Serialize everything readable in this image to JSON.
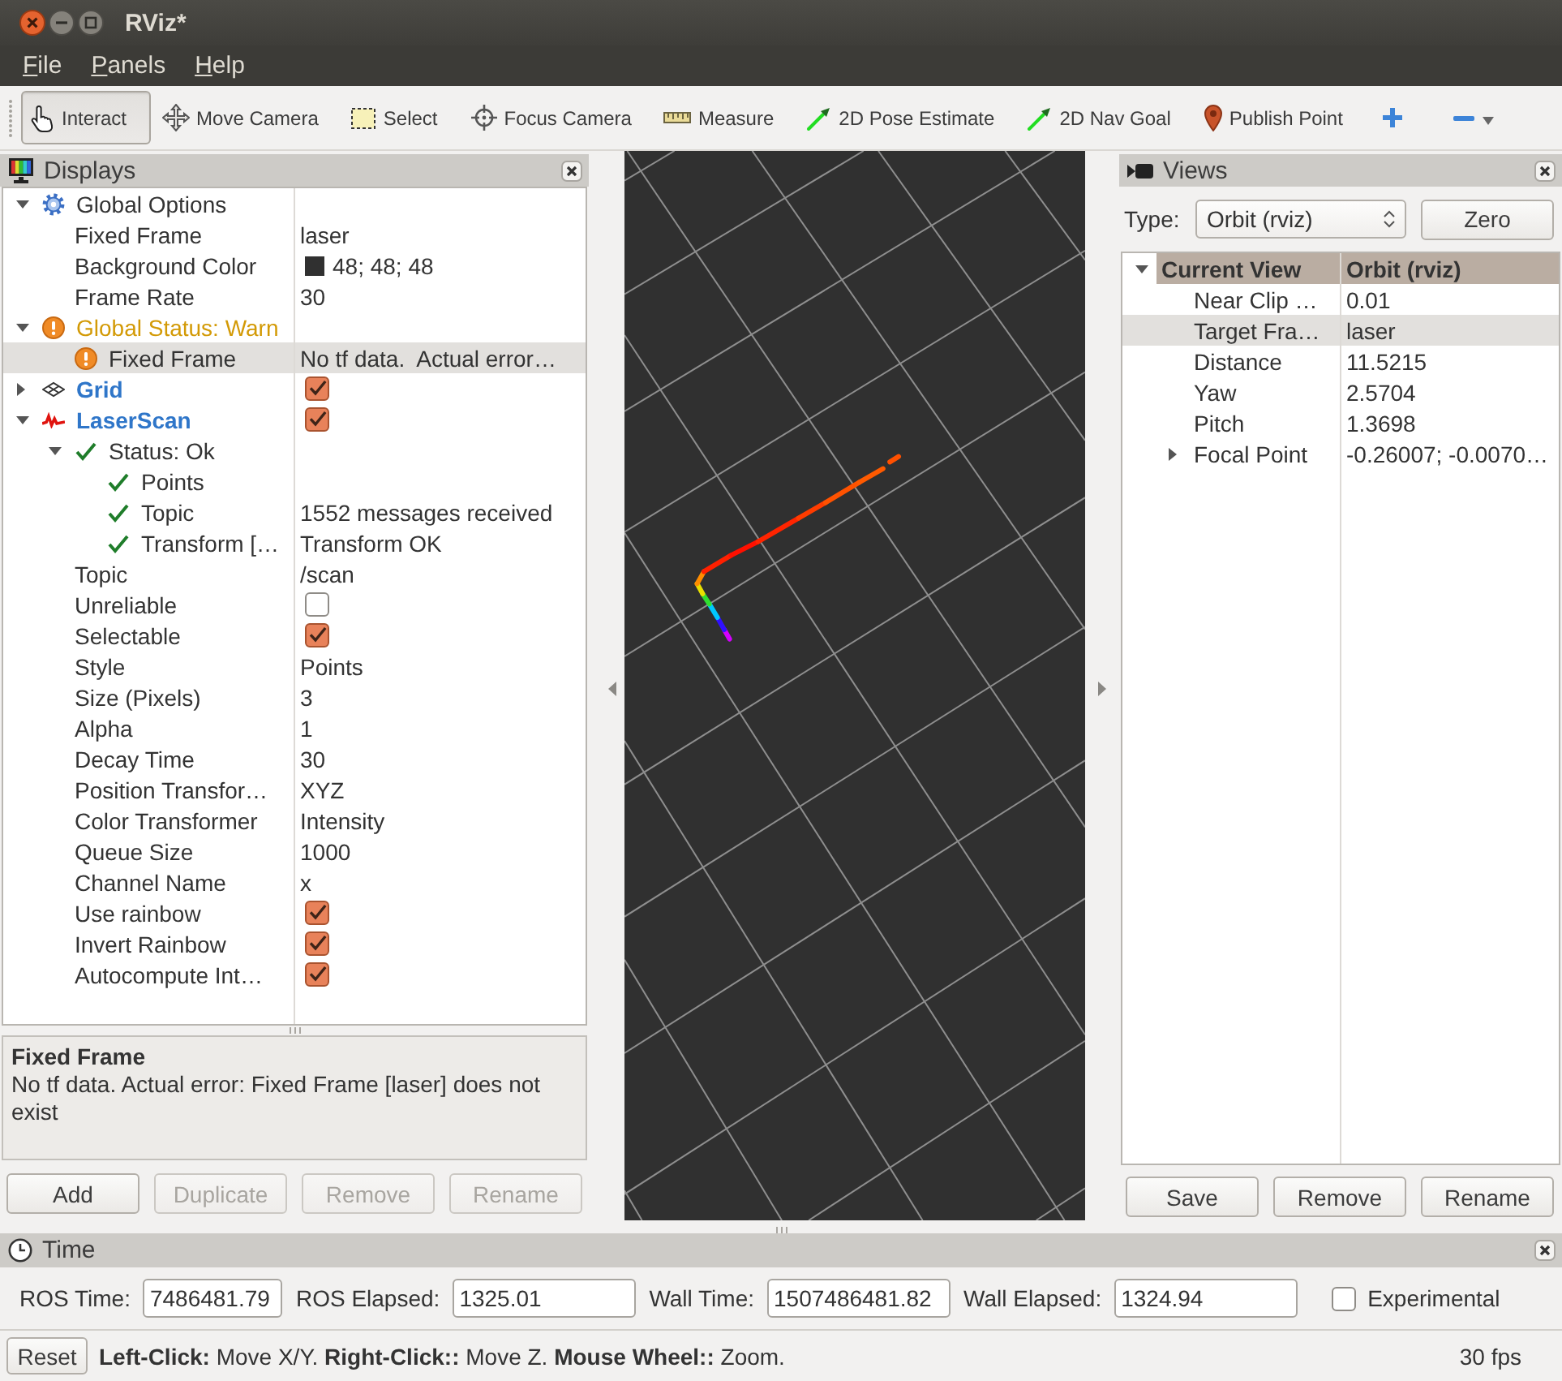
{
  "window": {
    "title": "RViz*"
  },
  "menu": [
    "File",
    "Panels",
    "Help"
  ],
  "toolbar": [
    {
      "label": "Interact",
      "kind": "interact",
      "selected": true
    },
    {
      "label": "Move Camera",
      "kind": "movecamera",
      "selected": false
    },
    {
      "label": "Select",
      "kind": "select",
      "selected": false
    },
    {
      "label": "Focus Camera",
      "kind": "focus",
      "selected": false
    },
    {
      "label": "Measure",
      "kind": "measure",
      "selected": false
    },
    {
      "label": "2D Pose Estimate",
      "kind": "pose",
      "selected": false
    },
    {
      "label": "2D Nav Goal",
      "kind": "goal",
      "selected": false
    },
    {
      "label": "Publish Point",
      "kind": "point",
      "selected": false
    }
  ],
  "displays": {
    "title": "Displays",
    "tree": [
      {
        "kind": "options",
        "label": "Global Options",
        "expanded": true,
        "selected": false,
        "children": [
          {
            "kind": "text",
            "label": "Fixed Frame",
            "value": "laser",
            "selected": false
          },
          {
            "kind": "color",
            "label": "Background Color",
            "value": "48; 48; 48",
            "color": "#303030",
            "selected": false
          },
          {
            "kind": "text",
            "label": "Frame Rate",
            "value": "30",
            "selected": false
          }
        ]
      },
      {
        "kind": "warn",
        "label": "Global Status: Warn",
        "expanded": true,
        "selected": false,
        "children": [
          {
            "kind": "warn",
            "label": "Fixed Frame",
            "value": "No tf data.  Actual error…",
            "selected": true
          }
        ]
      },
      {
        "kind": "grid",
        "label": "Grid",
        "expanded": false,
        "checked": true,
        "selected": false
      },
      {
        "kind": "laserscan",
        "label": "LaserScan",
        "expanded": true,
        "checked": true,
        "selected": false,
        "children": [
          {
            "kind": "ok",
            "label": "Status: Ok",
            "expanded": true,
            "selected": false,
            "children": [
              {
                "kind": "ok",
                "label": "Points",
                "selected": false
              },
              {
                "kind": "ok",
                "label": "Topic",
                "value": "1552 messages received",
                "selected": false
              },
              {
                "kind": "ok",
                "label": "Transform […",
                "value": "Transform OK",
                "selected": false
              }
            ]
          },
          {
            "kind": "text",
            "label": "Topic",
            "value": "/scan",
            "selected": false
          },
          {
            "kind": "checkbox",
            "label": "Unreliable",
            "checked": false,
            "selected": false
          },
          {
            "kind": "checkbox",
            "label": "Selectable",
            "checked": true,
            "selected": false
          },
          {
            "kind": "text",
            "label": "Style",
            "value": "Points",
            "selected": false
          },
          {
            "kind": "text",
            "label": "Size (Pixels)",
            "value": "3",
            "selected": false
          },
          {
            "kind": "text",
            "label": "Alpha",
            "value": "1",
            "selected": false
          },
          {
            "kind": "text",
            "label": "Decay Time",
            "value": "30",
            "selected": false
          },
          {
            "kind": "text",
            "label": "Position Transfor…",
            "value": "XYZ",
            "selected": false
          },
          {
            "kind": "text",
            "label": "Color Transformer",
            "value": "Intensity",
            "selected": false
          },
          {
            "kind": "text",
            "label": "Queue Size",
            "value": "1000",
            "selected": false
          },
          {
            "kind": "text",
            "label": "Channel Name",
            "value": "x",
            "selected": false
          },
          {
            "kind": "checkbox",
            "label": "Use rainbow",
            "checked": true,
            "selected": false
          },
          {
            "kind": "checkbox",
            "label": "Invert Rainbow",
            "checked": true,
            "selected": false
          },
          {
            "kind": "checkbox",
            "label": "Autocompute Int…",
            "checked": true,
            "selected": false
          }
        ]
      }
    ],
    "description": {
      "title": "Fixed Frame",
      "text": "No tf data. Actual error: Fixed Frame [laser] does not exist"
    },
    "buttons": [
      {
        "label": "Add",
        "disabled": false
      },
      {
        "label": "Duplicate",
        "disabled": true
      },
      {
        "label": "Remove",
        "disabled": true
      },
      {
        "label": "Rename",
        "disabled": true
      }
    ]
  },
  "views": {
    "title": "Views",
    "type": {
      "label": "Type:",
      "value": "Orbit (rviz)"
    },
    "zero_button": "Zero",
    "tree": [
      {
        "kind": "category",
        "label": "Current View",
        "value": "Orbit (rviz)",
        "expanded": true,
        "selected": false,
        "children": [
          {
            "kind": "text",
            "label": "Near Clip …",
            "value": "0.01",
            "selected": false
          },
          {
            "kind": "text",
            "label": "Target Fra…",
            "value": "laser",
            "selected": true
          },
          {
            "kind": "text",
            "label": "Distance",
            "value": "11.5215",
            "selected": false
          },
          {
            "kind": "text",
            "label": "Yaw",
            "value": "2.5704",
            "selected": false
          },
          {
            "kind": "text",
            "label": "Pitch",
            "value": "1.3698",
            "selected": false
          },
          {
            "kind": "text",
            "label": "Focal Point",
            "value": "-0.26007; -0.0070…",
            "expanded": false,
            "selected": false
          }
        ]
      }
    ],
    "buttons": [
      {
        "label": "Save",
        "disabled": false
      },
      {
        "label": "Remove",
        "disabled": false
      },
      {
        "label": "Rename",
        "disabled": false
      }
    ]
  },
  "time": {
    "title": "Time",
    "fields": [
      {
        "label": "ROS Time:",
        "value": "7486481.79"
      },
      {
        "label": "ROS Elapsed:",
        "value": "1325.01"
      },
      {
        "label": "Wall Time:",
        "value": "1507486481.82"
      },
      {
        "label": "Wall Elapsed:",
        "value": "1324.94"
      }
    ],
    "experimental": {
      "label": "Experimental",
      "checked": false
    }
  },
  "status_bar": {
    "reset_button": "Reset",
    "help": "**Left-Click:** Move X/Y. **Right-Click::** Move Z. **Mouse Wheel::** Zoom.",
    "fps": "30 fps"
  }
}
